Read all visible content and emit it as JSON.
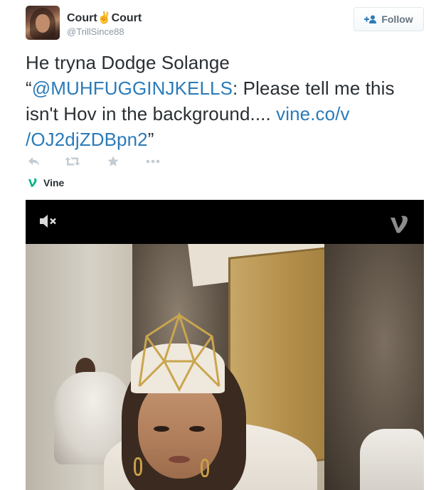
{
  "author": {
    "fullname": "Court✌Court",
    "username": "@TrillSince88"
  },
  "follow": {
    "label": "Follow",
    "icon": "follow-user-icon"
  },
  "tweet": {
    "line1": "He tryna Dodge Solange",
    "quote_open": "“",
    "mention": "@MUHFUGGINJKELLS",
    "quote_text": ": Please tell me this isn't Hov in the background.... ",
    "link_part1": "vine.co/v",
    "link_part2": "/OJ2djZDBpn2",
    "quote_close": "”"
  },
  "actions": [
    {
      "name": "reply",
      "icon": "reply-icon"
    },
    {
      "name": "retweet",
      "icon": "retweet-icon"
    },
    {
      "name": "favorite",
      "icon": "star-icon"
    },
    {
      "name": "more",
      "icon": "more-icon"
    }
  ],
  "card": {
    "source_label": "Vine",
    "source_icon": "vine-icon"
  },
  "video": {
    "mute_icon": "mute-icon",
    "watermark_icon": "vine-watermark-icon"
  },
  "colors": {
    "link": "#2b7bb9",
    "vine_green": "#00b488",
    "muted_icon": "#8899a6"
  }
}
